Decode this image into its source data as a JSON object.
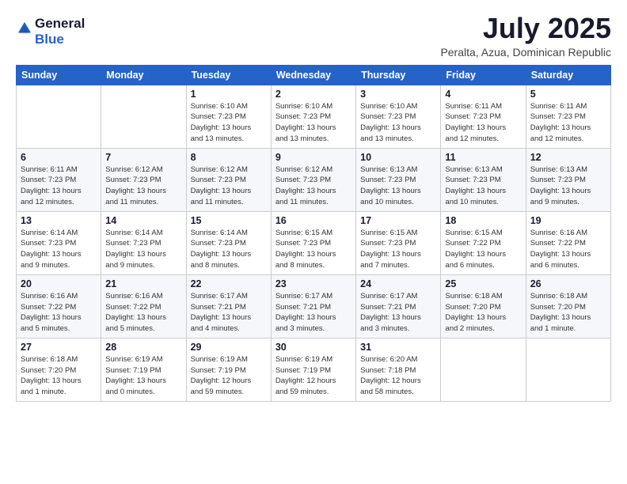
{
  "logo": {
    "general": "General",
    "blue": "Blue"
  },
  "title": "July 2025",
  "subtitle": "Peralta, Azua, Dominican Republic",
  "headers": [
    "Sunday",
    "Monday",
    "Tuesday",
    "Wednesday",
    "Thursday",
    "Friday",
    "Saturday"
  ],
  "weeks": [
    [
      {
        "day": "",
        "info": ""
      },
      {
        "day": "",
        "info": ""
      },
      {
        "day": "1",
        "info": "Sunrise: 6:10 AM\nSunset: 7:23 PM\nDaylight: 13 hours\nand 13 minutes."
      },
      {
        "day": "2",
        "info": "Sunrise: 6:10 AM\nSunset: 7:23 PM\nDaylight: 13 hours\nand 13 minutes."
      },
      {
        "day": "3",
        "info": "Sunrise: 6:10 AM\nSunset: 7:23 PM\nDaylight: 13 hours\nand 13 minutes."
      },
      {
        "day": "4",
        "info": "Sunrise: 6:11 AM\nSunset: 7:23 PM\nDaylight: 13 hours\nand 12 minutes."
      },
      {
        "day": "5",
        "info": "Sunrise: 6:11 AM\nSunset: 7:23 PM\nDaylight: 13 hours\nand 12 minutes."
      }
    ],
    [
      {
        "day": "6",
        "info": "Sunrise: 6:11 AM\nSunset: 7:23 PM\nDaylight: 13 hours\nand 12 minutes."
      },
      {
        "day": "7",
        "info": "Sunrise: 6:12 AM\nSunset: 7:23 PM\nDaylight: 13 hours\nand 11 minutes."
      },
      {
        "day": "8",
        "info": "Sunrise: 6:12 AM\nSunset: 7:23 PM\nDaylight: 13 hours\nand 11 minutes."
      },
      {
        "day": "9",
        "info": "Sunrise: 6:12 AM\nSunset: 7:23 PM\nDaylight: 13 hours\nand 11 minutes."
      },
      {
        "day": "10",
        "info": "Sunrise: 6:13 AM\nSunset: 7:23 PM\nDaylight: 13 hours\nand 10 minutes."
      },
      {
        "day": "11",
        "info": "Sunrise: 6:13 AM\nSunset: 7:23 PM\nDaylight: 13 hours\nand 10 minutes."
      },
      {
        "day": "12",
        "info": "Sunrise: 6:13 AM\nSunset: 7:23 PM\nDaylight: 13 hours\nand 9 minutes."
      }
    ],
    [
      {
        "day": "13",
        "info": "Sunrise: 6:14 AM\nSunset: 7:23 PM\nDaylight: 13 hours\nand 9 minutes."
      },
      {
        "day": "14",
        "info": "Sunrise: 6:14 AM\nSunset: 7:23 PM\nDaylight: 13 hours\nand 9 minutes."
      },
      {
        "day": "15",
        "info": "Sunrise: 6:14 AM\nSunset: 7:23 PM\nDaylight: 13 hours\nand 8 minutes."
      },
      {
        "day": "16",
        "info": "Sunrise: 6:15 AM\nSunset: 7:23 PM\nDaylight: 13 hours\nand 8 minutes."
      },
      {
        "day": "17",
        "info": "Sunrise: 6:15 AM\nSunset: 7:23 PM\nDaylight: 13 hours\nand 7 minutes."
      },
      {
        "day": "18",
        "info": "Sunrise: 6:15 AM\nSunset: 7:22 PM\nDaylight: 13 hours\nand 6 minutes."
      },
      {
        "day": "19",
        "info": "Sunrise: 6:16 AM\nSunset: 7:22 PM\nDaylight: 13 hours\nand 6 minutes."
      }
    ],
    [
      {
        "day": "20",
        "info": "Sunrise: 6:16 AM\nSunset: 7:22 PM\nDaylight: 13 hours\nand 5 minutes."
      },
      {
        "day": "21",
        "info": "Sunrise: 6:16 AM\nSunset: 7:22 PM\nDaylight: 13 hours\nand 5 minutes."
      },
      {
        "day": "22",
        "info": "Sunrise: 6:17 AM\nSunset: 7:21 PM\nDaylight: 13 hours\nand 4 minutes."
      },
      {
        "day": "23",
        "info": "Sunrise: 6:17 AM\nSunset: 7:21 PM\nDaylight: 13 hours\nand 3 minutes."
      },
      {
        "day": "24",
        "info": "Sunrise: 6:17 AM\nSunset: 7:21 PM\nDaylight: 13 hours\nand 3 minutes."
      },
      {
        "day": "25",
        "info": "Sunrise: 6:18 AM\nSunset: 7:20 PM\nDaylight: 13 hours\nand 2 minutes."
      },
      {
        "day": "26",
        "info": "Sunrise: 6:18 AM\nSunset: 7:20 PM\nDaylight: 13 hours\nand 1 minute."
      }
    ],
    [
      {
        "day": "27",
        "info": "Sunrise: 6:18 AM\nSunset: 7:20 PM\nDaylight: 13 hours\nand 1 minute."
      },
      {
        "day": "28",
        "info": "Sunrise: 6:19 AM\nSunset: 7:19 PM\nDaylight: 13 hours\nand 0 minutes."
      },
      {
        "day": "29",
        "info": "Sunrise: 6:19 AM\nSunset: 7:19 PM\nDaylight: 12 hours\nand 59 minutes."
      },
      {
        "day": "30",
        "info": "Sunrise: 6:19 AM\nSunset: 7:19 PM\nDaylight: 12 hours\nand 59 minutes."
      },
      {
        "day": "31",
        "info": "Sunrise: 6:20 AM\nSunset: 7:18 PM\nDaylight: 12 hours\nand 58 minutes."
      },
      {
        "day": "",
        "info": ""
      },
      {
        "day": "",
        "info": ""
      }
    ]
  ]
}
